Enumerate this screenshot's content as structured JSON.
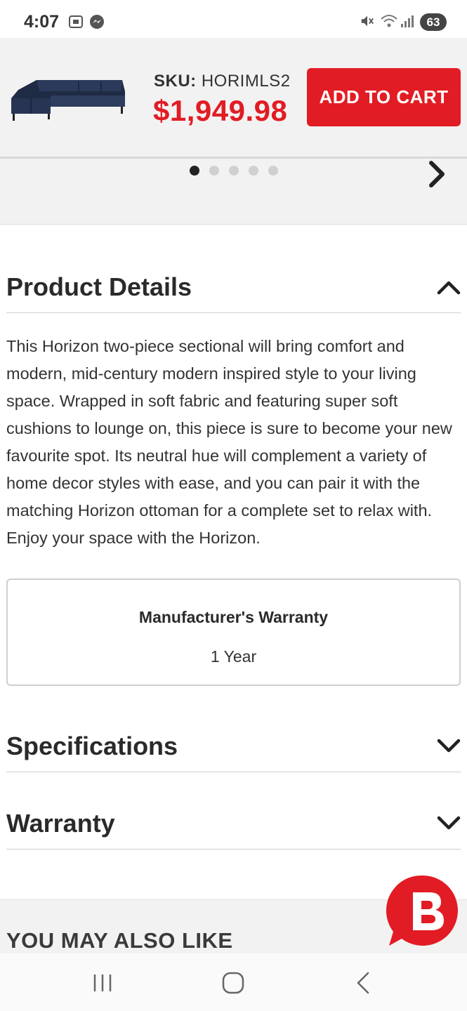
{
  "status_bar": {
    "time": "4:07",
    "battery": "63",
    "icons": [
      "screenshot-icon",
      "messenger-icon",
      "mute-icon",
      "wifi-icon",
      "signal-icon",
      "battery-icon"
    ]
  },
  "sticky_bar": {
    "sku_label": "SKU:",
    "sku_value": "HORIMLS2",
    "price": "$1,949.98",
    "add_to_cart": "ADD TO CART"
  },
  "carousel": {
    "total_slides": 5,
    "active_slide": 1
  },
  "product_details": {
    "title": "Product Details",
    "expanded": true,
    "description": "This Horizon two-piece sectional will bring comfort and modern, mid-century modern inspired style to your living space. Wrapped in soft fabric and featuring super soft cushions to lounge on, this piece is sure to become your new favourite spot. Its neutral hue will complement a variety of home decor styles with ease, and you can pair it with the matching Horizon ottoman for a complete set to relax with. Enjoy your space with the Horizon."
  },
  "warranty_box": {
    "title": "Manufacturer's Warranty",
    "value": "1 Year"
  },
  "specifications": {
    "title": "Specifications",
    "expanded": false
  },
  "warranty": {
    "title": "Warranty",
    "expanded": false
  },
  "also_like": {
    "title": "YOU MAY ALSO LIKE"
  },
  "colors": {
    "brand_red": "#e21c24",
    "background_gray": "#f2f2f2",
    "text_dark": "#2a2a2a"
  },
  "nav_bar": {
    "buttons": [
      "recent-apps",
      "home",
      "back"
    ]
  }
}
